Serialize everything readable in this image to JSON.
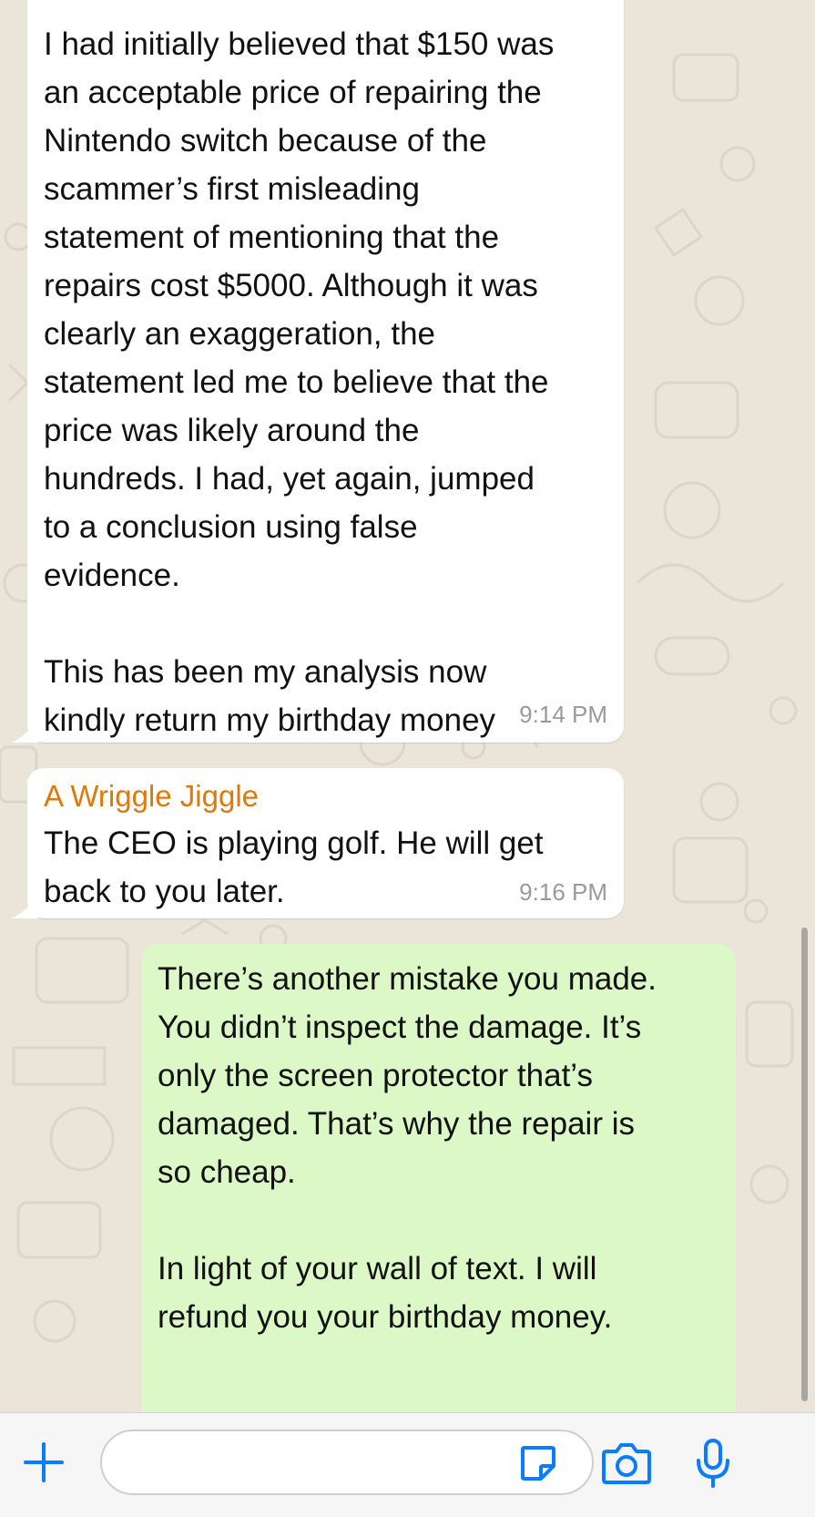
{
  "chat": {
    "messages": [
      {
        "direction": "incoming",
        "sender": "",
        "text": "I had initially believed that $150 was\nan acceptable price of repairing the\nNintendo switch because of the\nscammer’s first misleading\nstatement of mentioning that the\nrepairs cost $5000. Although it was\nclearly an exaggeration, the\nstatement led me to believe that the\nprice was likely around the\nhundreds. I had, yet again, jumped\nto a conclusion using false\nevidence.\n\nThis has been my analysis now\nkindly return my birthday money",
        "time": "9:14 PM"
      },
      {
        "direction": "incoming",
        "sender": "A Wriggle Jiggle",
        "text": "The CEO is playing golf. He will get\nback to you later.",
        "time": "9:16 PM"
      },
      {
        "direction": "outgoing",
        "sender": "",
        "text": "There’s another mistake you made.\nYou didn’t inspect the damage. It’s\nonly the screen protector that’s\ndamaged. That’s why the repair is\nso cheap.\n\nIn light of your wall of text. I will\nrefund you your birthday money.",
        "time": ""
      }
    ]
  },
  "input_bar": {
    "message_value": "",
    "icons": {
      "add": "plus-icon",
      "sticker": "sticker-icon",
      "camera": "camera-icon",
      "mic": "microphone-icon"
    }
  },
  "colors": {
    "accent": "#0a7cff",
    "sender_name": "#e0790b",
    "incoming_bubble": "#ffffff",
    "outgoing_bubble": "#dcf8c6",
    "chat_background": "#ebe4d9"
  }
}
